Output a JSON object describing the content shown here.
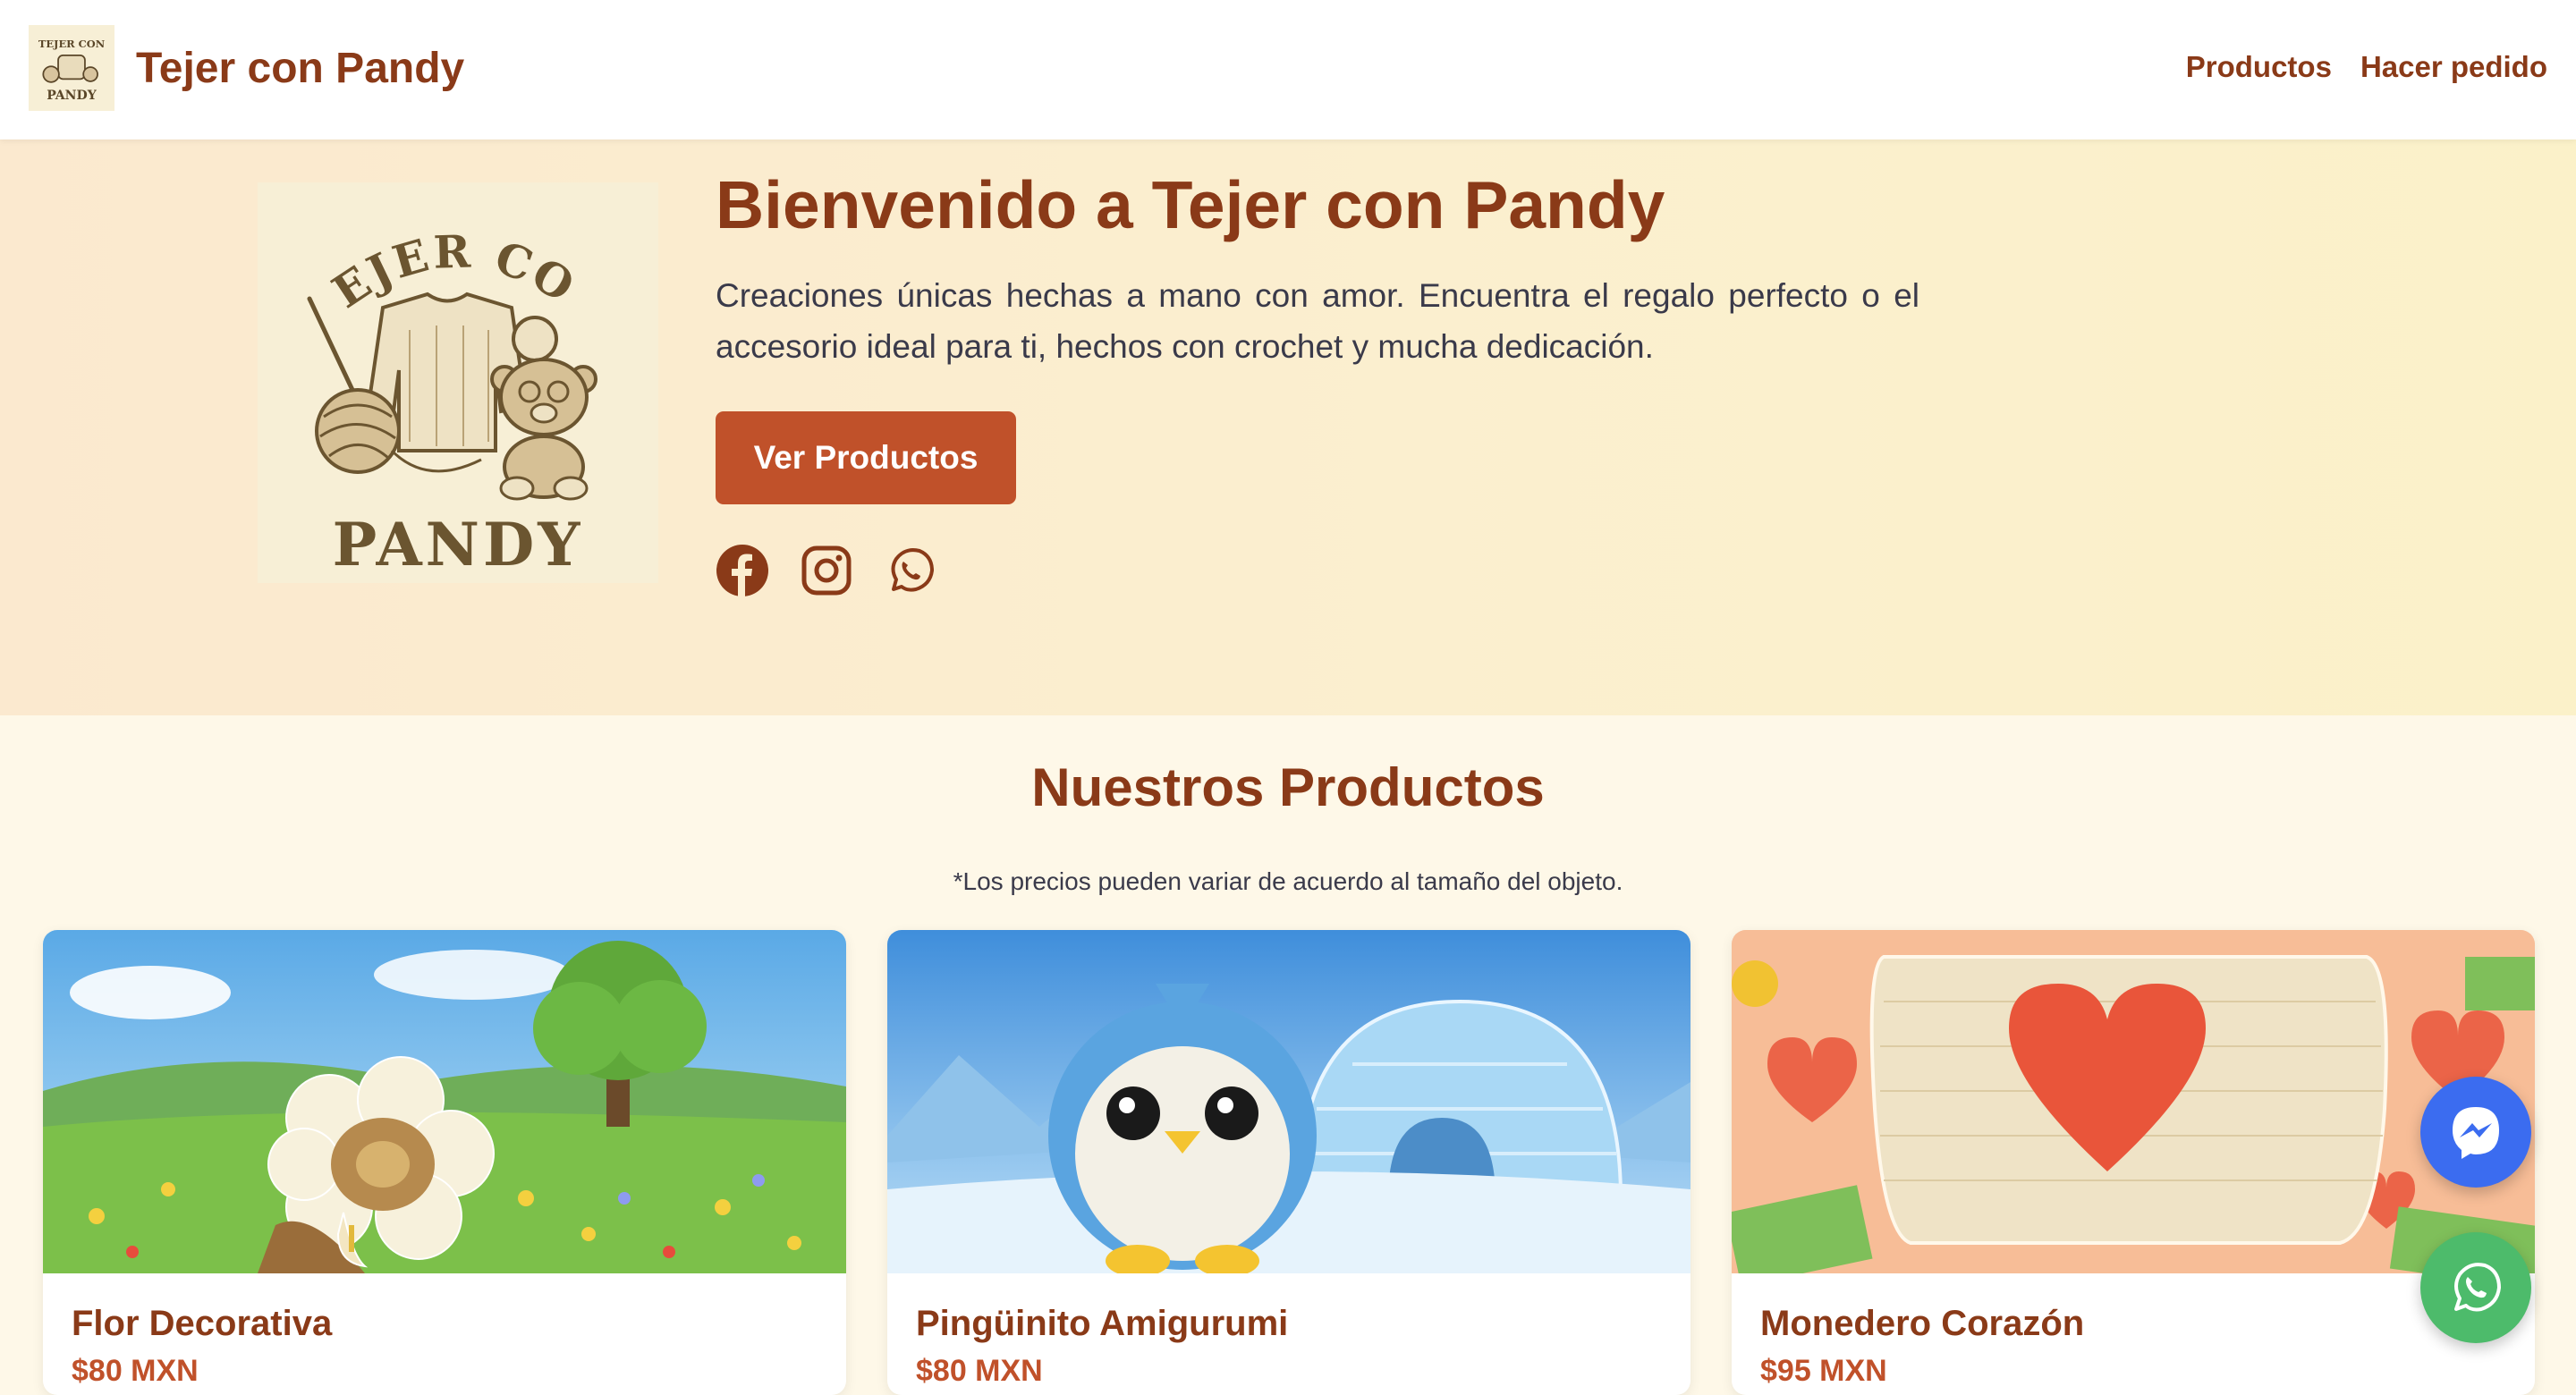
{
  "header": {
    "brand_name": "Tejer con Pandy",
    "nav": [
      {
        "label": "Productos"
      },
      {
        "label": "Hacer pedido"
      }
    ]
  },
  "hero": {
    "logo_text_top": "TEJER CON",
    "logo_text_bottom": "PANDY",
    "title": "Bienvenido a Tejer con Pandy",
    "description": "Creaciones únicas hechas a mano con amor. Encuentra el regalo perfecto o el accesorio ideal para ti, hechos con crochet y mucha dedicación.",
    "cta_label": "Ver Productos",
    "socials": [
      "facebook-icon",
      "instagram-icon",
      "whatsapp-icon"
    ]
  },
  "products": {
    "title": "Nuestros Productos",
    "note": "*Los precios pueden variar de acuerdo al tamaño del objeto.",
    "items": [
      {
        "name": "Flor Decorativa",
        "price": "$80 MXN"
      },
      {
        "name": "Pingüinito Amigurumi",
        "price": "$80 MXN"
      },
      {
        "name": "Monedero Corazón",
        "price": "$95 MXN"
      }
    ]
  },
  "floating": [
    "messenger-icon",
    "whatsapp-icon"
  ],
  "colors": {
    "brand": "#8a3a18",
    "accent": "#c0512a",
    "hero_bg": "#fbedcf",
    "page_bg": "#fef8e8",
    "messenger": "#3b6cf0",
    "whatsapp": "#4dbb6b"
  }
}
